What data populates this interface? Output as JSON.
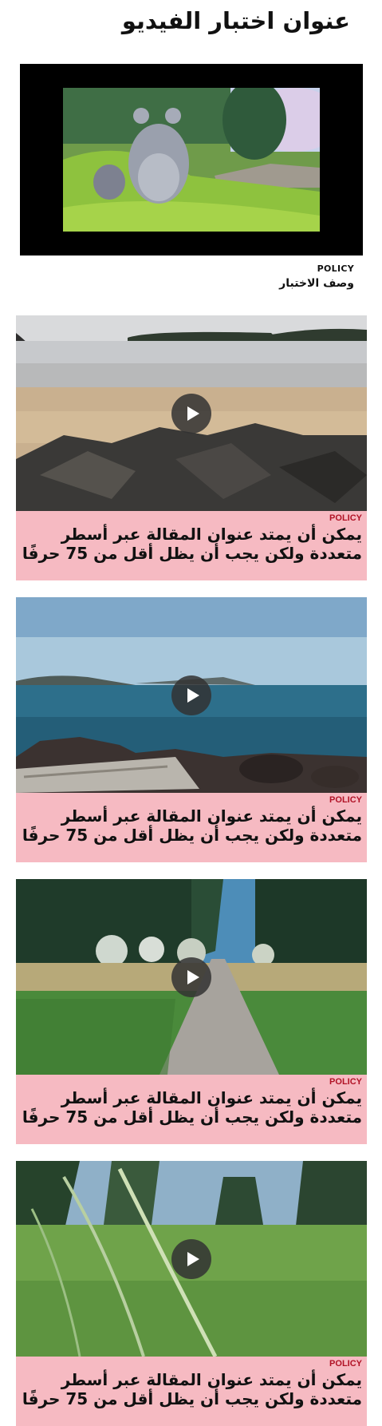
{
  "page": {
    "title": "عنوان اختبار الفيديو"
  },
  "feature": {
    "tag": "POLICY",
    "description": "وصف الاختبار"
  },
  "cards": [
    {
      "tag": "POLICY",
      "title": "يمكن أن يمتد عنوان المقالة عبر أسطر متعددة ولكن يجب أن يظل أقل من 75 حرفًا",
      "scene": "beach-rocks"
    },
    {
      "tag": "POLICY",
      "title": "يمكن أن يمتد عنوان المقالة عبر أسطر متعددة ولكن يجب أن يظل أقل من 75 حرفًا",
      "scene": "lake-shore"
    },
    {
      "tag": "POLICY",
      "title": "يمكن أن يمتد عنوان المقالة عبر أسطر متعددة ولكن يجب أن يظل أقل من 75 حرفًا",
      "scene": "forest-path"
    },
    {
      "tag": "POLICY",
      "title": "يمكن أن يمتد عنوان المقالة عبر أسطر متعددة ولكن يجب أن يظل أقل من 75 حرفًا",
      "scene": "grass-field"
    }
  ],
  "colors": {
    "card_background": "#f6bac2",
    "tag_red": "#b11226"
  },
  "icons": {
    "play": "play-icon"
  }
}
